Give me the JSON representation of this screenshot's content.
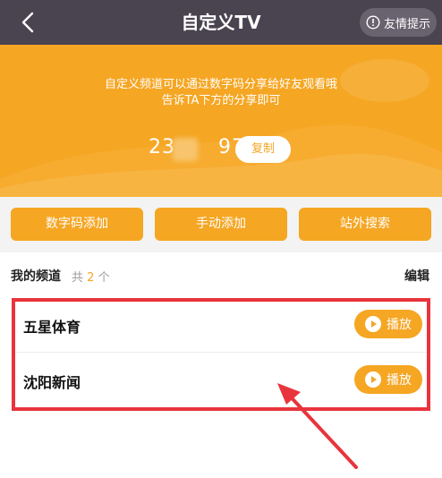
{
  "header": {
    "title": "自定义TV",
    "tip_label": "友情提示",
    "back_icon": "chevron-left-icon",
    "tip_icon": "info-icon"
  },
  "banner": {
    "line1": "自定义频道可以通过数字码分享给好友观看哦",
    "line2": "告诉TA下方的分享即可",
    "code": "23      97",
    "copy_label": "复制"
  },
  "actions": {
    "digit_add": "数字码添加",
    "manual_add": "手动添加",
    "offsite_search": "站外搜索"
  },
  "channels": {
    "title": "我的频道",
    "count_prefix": "共",
    "count": "2",
    "count_suffix": "个",
    "edit_label": "编辑",
    "items": [
      {
        "name": "五星体育",
        "play_label": "播放"
      },
      {
        "name": "沈阳新闻",
        "play_label": "播放"
      }
    ]
  },
  "colors": {
    "header_bg": "#4a4350",
    "accent": "#f5a623",
    "annotation_red": "#e8343c"
  }
}
